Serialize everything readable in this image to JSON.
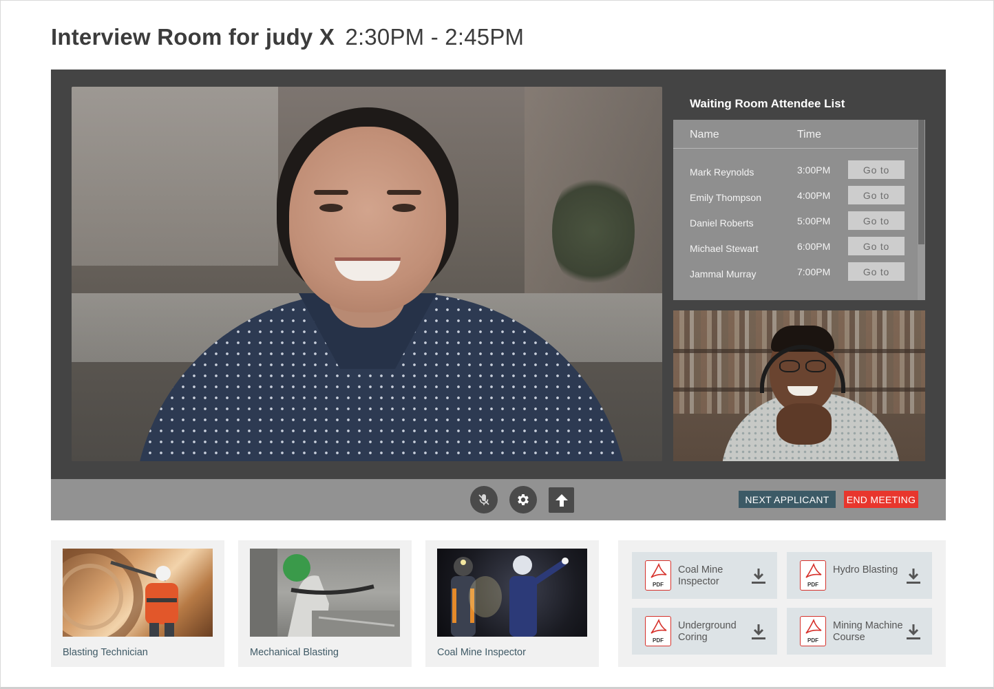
{
  "header": {
    "title_bold": "Interview Room  for judy X",
    "time_range": "2:30PM - 2:45PM"
  },
  "waiting_room": {
    "title": "Waiting Room Attendee List",
    "columns": {
      "name": "Name",
      "time": "Time"
    },
    "attendees": [
      {
        "name": "Mark Reynolds",
        "time": "3:00PM",
        "action": "Go to"
      },
      {
        "name": "Emily Thompson",
        "time": "4:00PM",
        "action": "Go to"
      },
      {
        "name": "Daniel Roberts",
        "time": "5:00PM",
        "action": "Go to"
      },
      {
        "name": "Michael Stewart",
        "time": "6:00PM",
        "action": "Go to"
      },
      {
        "name": "Jammal Murray",
        "time": "7:00PM",
        "action": "Go to"
      }
    ]
  },
  "controls": {
    "icons": [
      "mic-off-icon",
      "gear-icon",
      "upload-arrow-icon"
    ],
    "next_label": "NEXT APPLICANT",
    "end_label": "END MEETING",
    "colors": {
      "next": "#3c5a66",
      "end": "#e8362d"
    }
  },
  "courses": [
    {
      "label": "Blasting Technician"
    },
    {
      "label": "Mechanical Blasting"
    },
    {
      "label": "Coal Mine Inspector"
    }
  ],
  "documents": [
    {
      "name": "Coal Mine Inspector",
      "type": "PDF"
    },
    {
      "name": "Hydro Blasting",
      "type": "PDF"
    },
    {
      "name": "Underground Coring",
      "type": "PDF"
    },
    {
      "name": "Mining Machine Course",
      "type": "PDF"
    }
  ]
}
